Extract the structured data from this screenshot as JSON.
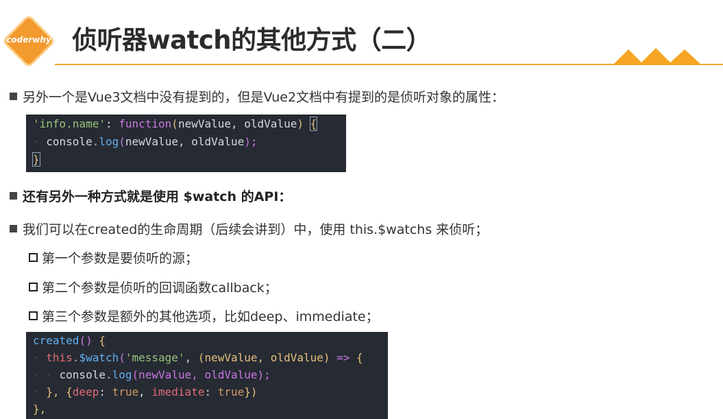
{
  "header": {
    "logo_text": "coderwhy",
    "title": "侦听器watch的其他方式（二）"
  },
  "bullets": {
    "b1": "另外一个是Vue3文档中没有提到的，但是Vue2文档中有提到的是侦听对象的属性：",
    "b2": "还有另外一种方式就是使用 $watch 的API：",
    "b3": "我们可以在created的生命周期（后续会讲到）中，使用 this.$watchs 来侦听；",
    "sub1": "第一个参数是要侦听的源；",
    "sub2": "第二个参数是侦听的回调函数callback；",
    "sub3": "第三个参数是额外的其他选项，比如deep、immediate；"
  },
  "code1": {
    "l1_key": "'info.name'",
    "l1_colon": ": ",
    "l1_fn": "function",
    "l1_open": "(",
    "l1_args": "newValue, oldValue",
    "l1_close": ")",
    "l1_brace": "{",
    "l2_obj": "console",
    "l2_dot": ".",
    "l2_method": "log",
    "l2_open": "(",
    "l2_args": "newValue, oldValue",
    "l2_close": ");",
    "l3_brace": "}"
  },
  "code2": {
    "l1_fn": "created",
    "l1_parens": "()",
    "l1_brace": "{",
    "l2_this": "this",
    "l2_dot": ".",
    "l2_method": "$watch",
    "l2_open": "(",
    "l2_str": "'message'",
    "l2_comma": ", ",
    "l2_args": "(newValue, oldValue)",
    "l2_arrow": "=>",
    "l2_brace": "{",
    "l3_obj": "console",
    "l3_dot": ".",
    "l3_method": "log",
    "l3_args": "(newValue, oldValue);",
    "l4_close": "}, {",
    "l4_k1": "deep",
    "l4_c1": ": ",
    "l4_v1": "true",
    "l4_sep": ", ",
    "l4_k2": "imediate",
    "l4_c2": ": ",
    "l4_v2": "true",
    "l4_end": "})",
    "l5_end": "},"
  },
  "colors": {
    "accent": "#f0a53a",
    "code_bg": "#262a33"
  }
}
